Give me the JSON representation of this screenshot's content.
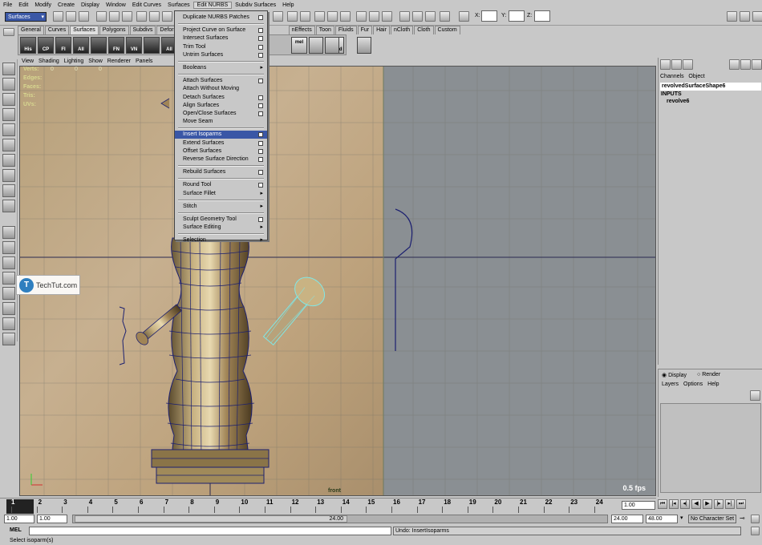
{
  "menubar": [
    "File",
    "Edit",
    "Modify",
    "Create",
    "Display",
    "Window",
    "Edit Curves",
    "Surfaces",
    "Edit NURBS",
    "Subdiv Surfaces",
    "Help"
  ],
  "menubar_active": "Edit NURBS",
  "status": {
    "mode": "Surfaces",
    "x_label": "X:",
    "y_label": "Y:",
    "z_label": "Z:"
  },
  "shelf_tabs": [
    "General",
    "Curves",
    "Surfaces",
    "Polygons",
    "Subdivs",
    "Deformation",
    "nEffects",
    "Toon",
    "Fluids",
    "Fur",
    "Hair",
    "nCloth",
    "Cloth",
    "Custom"
  ],
  "shelf_buttons": [
    "His",
    "CP",
    "FI",
    "All",
    "",
    "FN",
    "VN",
    "",
    "All"
  ],
  "shelf_extra": [
    "mel",
    "Hshd"
  ],
  "panel_menu": [
    "View",
    "Shading",
    "Lighting",
    "Show",
    "Renderer",
    "Panels"
  ],
  "hud": {
    "labels": [
      "Verts:",
      "Edges:",
      "Faces:",
      "Tris:",
      "UVs:"
    ],
    "values": [
      "0",
      "0",
      "0"
    ]
  },
  "viewport": {
    "camera_label": "front",
    "fps": "0.5 fps"
  },
  "edit_nurbs_menu": [
    {
      "label": "Duplicate NURBS Patches",
      "opt": true
    },
    {
      "sep": true
    },
    {
      "label": "Project Curve on Surface",
      "opt": true
    },
    {
      "label": "Intersect Surfaces",
      "opt": true
    },
    {
      "label": "Trim Tool",
      "opt": true
    },
    {
      "label": "Untrim Surfaces",
      "opt": true
    },
    {
      "sep": true
    },
    {
      "label": "Booleans",
      "arrow": true
    },
    {
      "sep": true
    },
    {
      "label": "Attach Surfaces",
      "opt": true
    },
    {
      "label": "Attach Without Moving"
    },
    {
      "label": "Detach Surfaces",
      "opt": true
    },
    {
      "label": "Align Surfaces",
      "opt": true
    },
    {
      "label": "Open/Close Surfaces",
      "opt": true
    },
    {
      "label": "Move Seam"
    },
    {
      "sep": true
    },
    {
      "label": "Insert Isoparms",
      "opt": true,
      "highlight": true
    },
    {
      "label": "Extend Surfaces",
      "opt": true
    },
    {
      "label": "Offset Surfaces",
      "opt": true
    },
    {
      "label": "Reverse Surface Direction",
      "opt": true
    },
    {
      "sep": true
    },
    {
      "label": "Rebuild Surfaces",
      "opt": true
    },
    {
      "sep": true
    },
    {
      "label": "Round Tool",
      "opt": true
    },
    {
      "label": "Surface Fillet",
      "arrow": true
    },
    {
      "sep": true
    },
    {
      "label": "Stitch",
      "arrow": true
    },
    {
      "sep": true
    },
    {
      "label": "Sculpt Geometry Tool",
      "opt": true
    },
    {
      "label": "Surface Editing",
      "arrow": true
    },
    {
      "sep": true
    },
    {
      "label": "Selection",
      "arrow": true
    }
  ],
  "watermark": {
    "icon_letter": "T",
    "text": "TechTut.com"
  },
  "channel_box": {
    "tabs": [
      "Channels",
      "Object"
    ],
    "node": "revolvedSurfaceShape6",
    "inputs_header": "INPUTS",
    "input_item": "revolve6"
  },
  "layer_panel": {
    "radio_display": "Display",
    "radio_render": "Render",
    "menu": [
      "Layers",
      "Options",
      "Help"
    ]
  },
  "time_slider": {
    "ticks": [
      "1",
      "2",
      "3",
      "4",
      "5",
      "6",
      "7",
      "8",
      "9",
      "10",
      "11",
      "12",
      "13",
      "14",
      "15",
      "16",
      "17",
      "18",
      "19",
      "20",
      "21",
      "22",
      "23",
      "24"
    ],
    "current": "1.00"
  },
  "range": {
    "start": "1.00",
    "playback_start": "1.00",
    "range_label": "24.00",
    "playback_end": "24.00",
    "end": "48.00",
    "character_set": "No Character Set"
  },
  "command": {
    "label": "MEL",
    "result": "Undo: InsertIsoparms"
  },
  "help_line": "Select isoparm(s)",
  "colors": {
    "ui_gray": "#c8c8c8",
    "highlight": "#3a57a6",
    "viewport_gray": "#8a8f93",
    "wire": "#1c2070",
    "selected_wire": "#7fe8e8"
  }
}
